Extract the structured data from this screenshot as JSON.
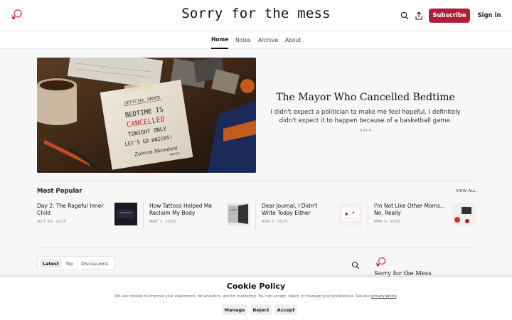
{
  "header": {
    "site_title": "Sorry for the mess",
    "subscribe_label": "Subscribe",
    "signin_label": "Sign in",
    "search_icon": "search-icon",
    "share_icon": "share-icon"
  },
  "nav": {
    "tabs": [
      {
        "label": "Home",
        "active": true
      },
      {
        "label": "Notes",
        "active": false
      },
      {
        "label": "Archive",
        "active": false
      },
      {
        "label": "About",
        "active": false
      }
    ]
  },
  "hero": {
    "title": "The Mayor Who Cancelled Bedtime",
    "subtitle": "I didn't expect a politician to make me feel hopeful. I definitely didn't expect it to happen because of a basketball game.",
    "date": "JUN 4",
    "image_text": {
      "official_order": "OFFICIAL ORDER",
      "line1": "BEDTIME IS",
      "line2": "CANCELLED",
      "line3": "TONIGHT ONLY",
      "line4": "LET'S GO KNICKS!",
      "signature": "Zohran Mamdani",
      "role": "MAYOR"
    }
  },
  "most_popular": {
    "title": "Most Popular",
    "view_all": "VIEW ALL",
    "items": [
      {
        "title": "Day 2: The Rageful Inner Child",
        "date": "OCT 16, 2025"
      },
      {
        "title": "How Tattoos Helped Me Reclaim My Body",
        "date": "MAY 7, 2025"
      },
      {
        "title": "Dear Journal, I Didn't Write Today Either",
        "date": "APR 7, 2025"
      },
      {
        "title": "I'm Not Like Other Moms... No, Really",
        "date": "MAY 6, 2025"
      }
    ]
  },
  "feed": {
    "tabs": [
      {
        "label": "Latest",
        "active": true
      },
      {
        "label": "Top",
        "active": false
      },
      {
        "label": "Discussions",
        "active": false
      }
    ]
  },
  "sidebar": {
    "title": "Sorry for the Mess"
  },
  "cookie": {
    "title": "Cookie Policy",
    "text": "We use cookies to improve your experience, for analytics, and for marketing. You can accept, reject, or manage your preferences. See our",
    "link": "privacy policy",
    "manage": "Manage",
    "reject": "Reject",
    "accept": "Accept"
  },
  "colors": {
    "accent": "#b01e3a"
  }
}
